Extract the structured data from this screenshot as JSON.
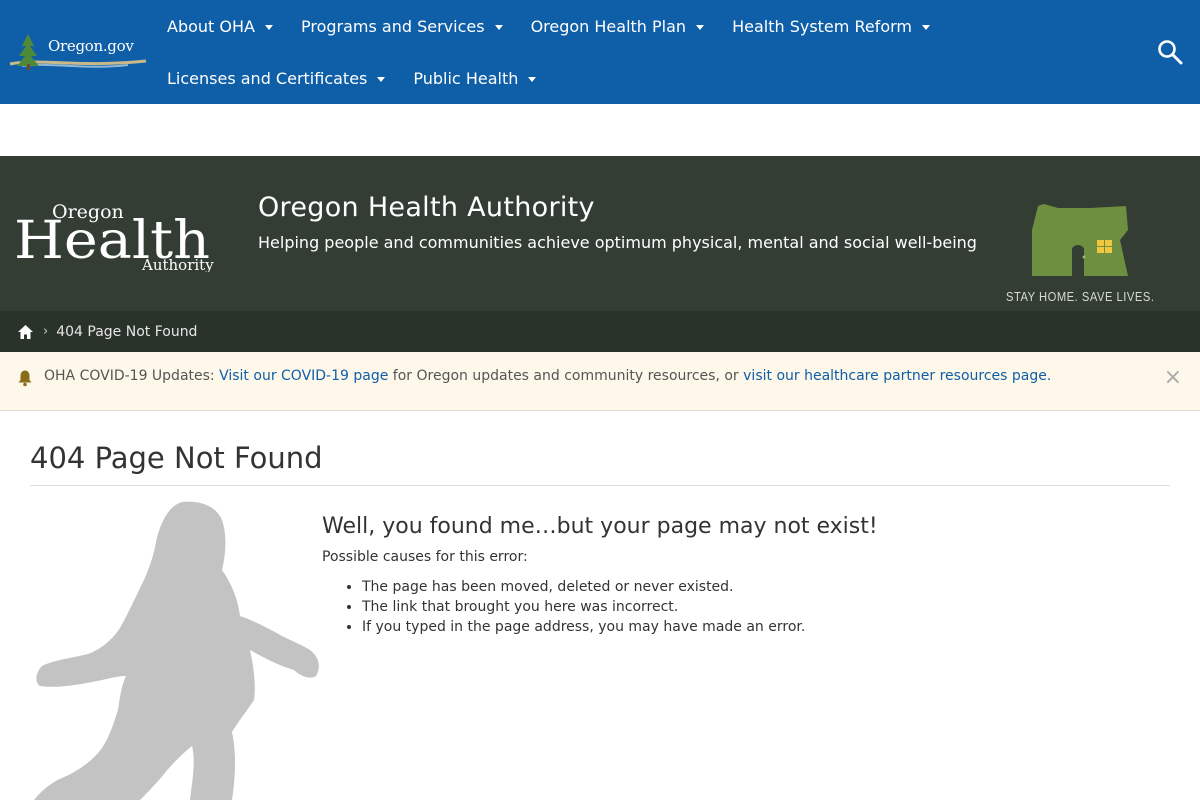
{
  "header": {
    "site_logo": "Oregon.gov",
    "nav_row1": [
      {
        "label": "About OHA"
      },
      {
        "label": "Programs and Services"
      },
      {
        "label": "Oregon Health Plan"
      },
      {
        "label": "Health System Reform"
      }
    ],
    "nav_row2": [
      {
        "label": "Licenses and Certificates"
      },
      {
        "label": "Public Health"
      }
    ],
    "search_icon": "search-icon",
    "nav_color": "#0f5ea8"
  },
  "banner": {
    "logo_text": "Oregon Health Authority",
    "logo_word_top": "Oregon",
    "logo_word_main": "Health",
    "logo_word_bottom": "Authority",
    "title": "Oregon Health Authority",
    "subtitle": "Helping people and communities achieve optimum physical, mental and social well-being",
    "campaign": "STAY HOME. SAVE LIVES.",
    "bg_color": "#333d33",
    "campaign_color": "#7a9a4a"
  },
  "breadcrumb": {
    "home_icon": "home-icon",
    "current": "404 Page Not Found"
  },
  "alert": {
    "icon": "bell-icon",
    "prefix": "OHA COVID-19 Updates:",
    "link1": "Visit our COVID-19 page",
    "middle": "for Oregon updates and community resources, or",
    "link2": "visit our healthcare partner resources page.",
    "close": "×"
  },
  "main": {
    "page_title": "404 Page Not Found",
    "heading": "Well, you found me…but your page may not exist!",
    "causes_label": "Possible causes for this error:",
    "causes": [
      "The page has been moved, deleted or never existed.",
      "The link that brought you here was incorrect.",
      "If you typed in the page address, you may have made an error."
    ],
    "illustration": "bigfoot-silhouette"
  }
}
